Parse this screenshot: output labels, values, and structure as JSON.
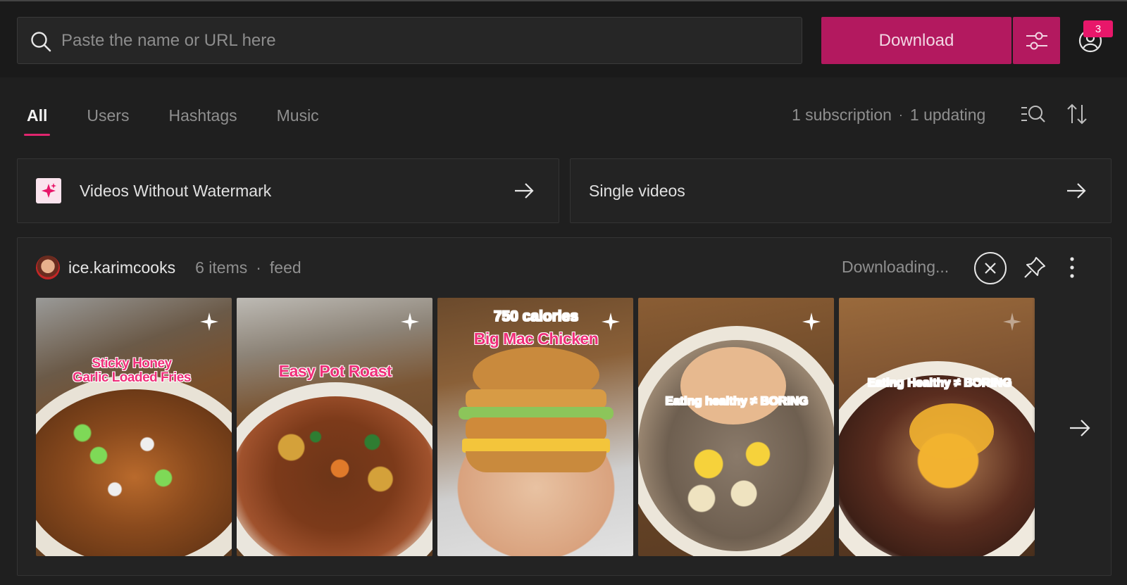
{
  "search": {
    "placeholder": "Paste the name or URL here"
  },
  "toolbar": {
    "download_label": "Download",
    "notification_count": "3"
  },
  "tabs": [
    {
      "label": "All",
      "active": true
    },
    {
      "label": "Users",
      "active": false
    },
    {
      "label": "Hashtags",
      "active": false
    },
    {
      "label": "Music",
      "active": false
    }
  ],
  "status": {
    "subscriptions": "1 subscription",
    "separator": "·",
    "updating": "1 updating"
  },
  "cards": [
    {
      "label": "Videos Without Watermark",
      "icon": "sparkle-icon"
    },
    {
      "label": "Single videos",
      "icon": "arrow-right-icon"
    }
  ],
  "feed": {
    "username": "ice.karimcooks",
    "items": "6 items",
    "separator": "·",
    "type": "feed",
    "status": "Downloading..."
  },
  "thumbnails": [
    {
      "caption_line1": "Sticky Honey",
      "caption_line2": "Garlic Loaded Fries"
    },
    {
      "caption_line1": "Easy Pot Roast"
    },
    {
      "caption_top": "750 calories",
      "caption_line1": "Big Mac Chicken"
    },
    {
      "caption_line1": "Eating healthy ≠ BORING"
    },
    {
      "caption_line1": "Eating Healthy ≠ BORING"
    }
  ],
  "colors": {
    "accent": "#b3195f",
    "badge": "#e8176a",
    "tab_underline": "#e0266e",
    "background": "#1f1f1f"
  }
}
